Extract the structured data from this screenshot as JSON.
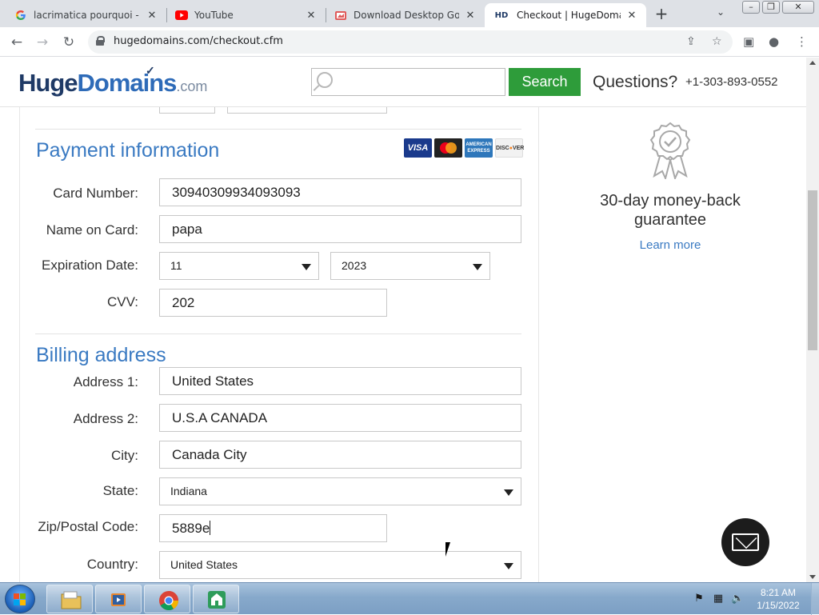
{
  "browser": {
    "tabs": [
      {
        "title": "lacrimatica pourquoi - Go",
        "icon": "google-icon",
        "active": false
      },
      {
        "title": "YouTube",
        "icon": "youtube-icon",
        "active": false
      },
      {
        "title": "Download Desktop Goose",
        "icon": "goose-icon",
        "active": false
      },
      {
        "title": "Checkout | HugeDomains",
        "icon": "hd-icon",
        "active": true
      }
    ],
    "url": "hugedomains.com/checkout.cfm",
    "window_controls": [
      "minimize",
      "restore",
      "close"
    ]
  },
  "site_header": {
    "logo_huge": "Huge",
    "logo_domains": "Domains",
    "logo_com": ".com",
    "search_placeholder": "",
    "search_button": "Search",
    "questions_label": "Questions?",
    "phone": "+1-303-893-0552"
  },
  "payment": {
    "title": "Payment information",
    "cards": [
      {
        "name": "VISA",
        "color": "#1a3a8c"
      },
      {
        "name": "mastercard",
        "color": "#222222"
      },
      {
        "name": "AMERICAN EXPRESS",
        "color": "#2e77bb"
      },
      {
        "name": "DISCOVER",
        "color": "#f2f2f2"
      }
    ],
    "card_number_label": "Card Number:",
    "card_number": "30940309934093093",
    "name_label": "Name on Card:",
    "name": "papa",
    "expiration_label": "Expiration Date:",
    "exp_month": "11",
    "exp_year": "2023",
    "cvv_label": "CVV:",
    "cvv": "202"
  },
  "billing": {
    "title": "Billing address",
    "address1_label": "Address 1:",
    "address1": "United States",
    "address2_label": "Address 2:",
    "address2": "U.S.A CANADA",
    "city_label": "City:",
    "city": "Canada City",
    "state_label": "State:",
    "state": "Indiana",
    "zip_label": "Zip/Postal Code:",
    "zip": "5889e",
    "country_label": "Country:",
    "country": "United States"
  },
  "sidebar": {
    "guarantee_line1": "30-day money-back",
    "guarantee_line2": "guarantee",
    "learn_more": "Learn more"
  },
  "taskbar": {
    "apps": [
      "explorer-icon",
      "media-player-icon",
      "chrome-icon",
      "goose-app-icon"
    ],
    "time": "8:21 AM",
    "date": "1/15/2022"
  },
  "colors": {
    "accent_blue": "#3a7ac2",
    "search_green": "#2e9c3a",
    "logo_navy": "#1f3a66"
  }
}
